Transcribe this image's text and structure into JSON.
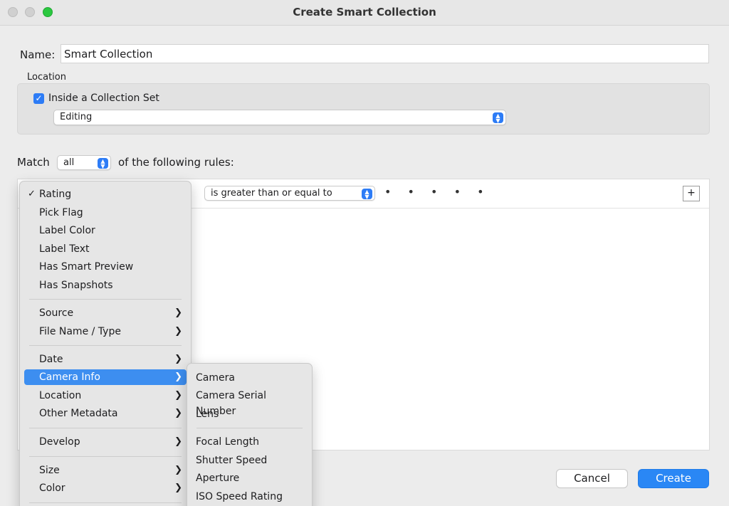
{
  "window": {
    "title": "Create Smart Collection"
  },
  "name": {
    "label": "Name:",
    "value": "Smart Collection"
  },
  "location": {
    "label": "Location",
    "checkbox_label": "Inside a Collection Set",
    "checked": true,
    "collection_set": "Editing"
  },
  "match": {
    "prefix": "Match",
    "mode": "all",
    "suffix": "of the following rules:"
  },
  "rule": {
    "operator": "is greater than or equal to",
    "rating_dots": "• • • • •",
    "add_button": "+"
  },
  "main_menu": {
    "group1": [
      {
        "label": "Rating",
        "checked": true
      },
      {
        "label": "Pick Flag"
      },
      {
        "label": "Label Color"
      },
      {
        "label": "Label Text"
      },
      {
        "label": "Has Smart Preview"
      },
      {
        "label": "Has Snapshots"
      }
    ],
    "group2": [
      {
        "label": "Source"
      },
      {
        "label": "File Name / Type"
      }
    ],
    "group3": [
      {
        "label": "Date"
      },
      {
        "label": "Camera Info",
        "highlighted": true
      },
      {
        "label": "Location"
      },
      {
        "label": "Other Metadata"
      }
    ],
    "group4": [
      {
        "label": "Develop"
      }
    ],
    "group5": [
      {
        "label": "Size"
      },
      {
        "label": "Color"
      }
    ]
  },
  "sub_menu": {
    "group1": [
      {
        "label": "Camera"
      },
      {
        "label": "Camera Serial Number"
      },
      {
        "label": "Lens"
      }
    ],
    "group2": [
      {
        "label": "Focal Length"
      },
      {
        "label": "Shutter Speed"
      },
      {
        "label": "Aperture"
      },
      {
        "label": "ISO Speed Rating"
      }
    ]
  },
  "buttons": {
    "cancel": "Cancel",
    "create": "Create"
  },
  "icons": {
    "checkmark": "checkmark-icon",
    "chevron": "chevron-right-icon",
    "stepper": "up-down-stepper-icon"
  },
  "colors": {
    "accent": "#2a87f5",
    "highlight": "#3d8ef0",
    "traffic_zoom": "#2bc840"
  }
}
